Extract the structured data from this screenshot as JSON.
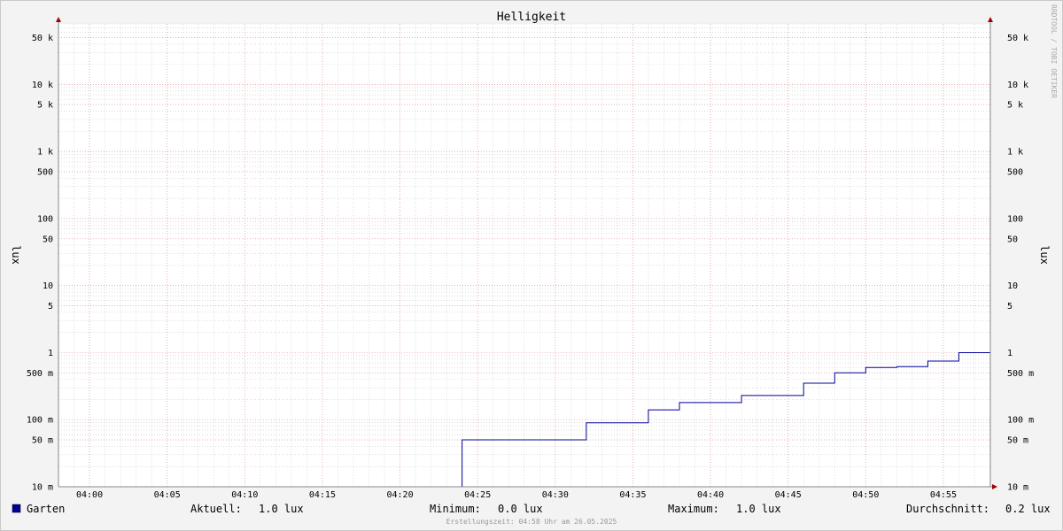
{
  "chart_data": {
    "type": "line",
    "title": "Helligkeit",
    "ylabel": "lux",
    "y_scale": "log",
    "ylim": [
      0.01,
      80000
    ],
    "x_ticks": [
      "04:00",
      "04:05",
      "04:10",
      "04:15",
      "04:20",
      "04:25",
      "04:30",
      "04:35",
      "04:40",
      "04:45",
      "04:50",
      "04:55"
    ],
    "y_ticks": [
      {
        "v": 0.01,
        "label": "10 m"
      },
      {
        "v": 0.05,
        "label": "50 m"
      },
      {
        "v": 0.1,
        "label": "100 m"
      },
      {
        "v": 0.5,
        "label": "500 m"
      },
      {
        "v": 1,
        "label": "1"
      },
      {
        "v": 5,
        "label": "5"
      },
      {
        "v": 10,
        "label": "10"
      },
      {
        "v": 50,
        "label": "50"
      },
      {
        "v": 100,
        "label": "100"
      },
      {
        "v": 500,
        "label": "500"
      },
      {
        "v": 1000,
        "label": "1 k"
      },
      {
        "v": 5000,
        "label": "5 k"
      },
      {
        "v": 10000,
        "label": "10 k"
      },
      {
        "v": 50000,
        "label": "50 k"
      }
    ],
    "grid": true,
    "series": [
      {
        "name": "Garten",
        "color": "#000099",
        "x": [
          "04:24",
          "04:32",
          "04:36",
          "04:38",
          "04:42",
          "04:46",
          "04:48",
          "04:50",
          "04:52",
          "04:54",
          "04:56"
        ],
        "values": [
          0.05,
          0.09,
          0.14,
          0.18,
          0.23,
          0.35,
          0.5,
          0.6,
          0.62,
          0.75,
          1.0
        ]
      }
    ]
  },
  "legend": {
    "series_name": "Garten",
    "series_color": "#000099",
    "current_label": "Aktuell:",
    "current_value": "1.0 lux",
    "min_label": "Minimum:",
    "min_value": "0.0 lux",
    "max_label": "Maximum:",
    "max_value": "1.0 lux",
    "avg_label": "Durchschnitt:",
    "avg_value": "0.2 lux"
  },
  "footer": "Erstellungszeit: 04:58 Uhr am 26.05.2025",
  "watermark": "RRDTOOL / TOBI OETIKER",
  "colors": {
    "major_grid": "#e8a0a0",
    "minor_grid": "#c8c8c8",
    "axis": "#888888",
    "arrow": "#a00000"
  }
}
